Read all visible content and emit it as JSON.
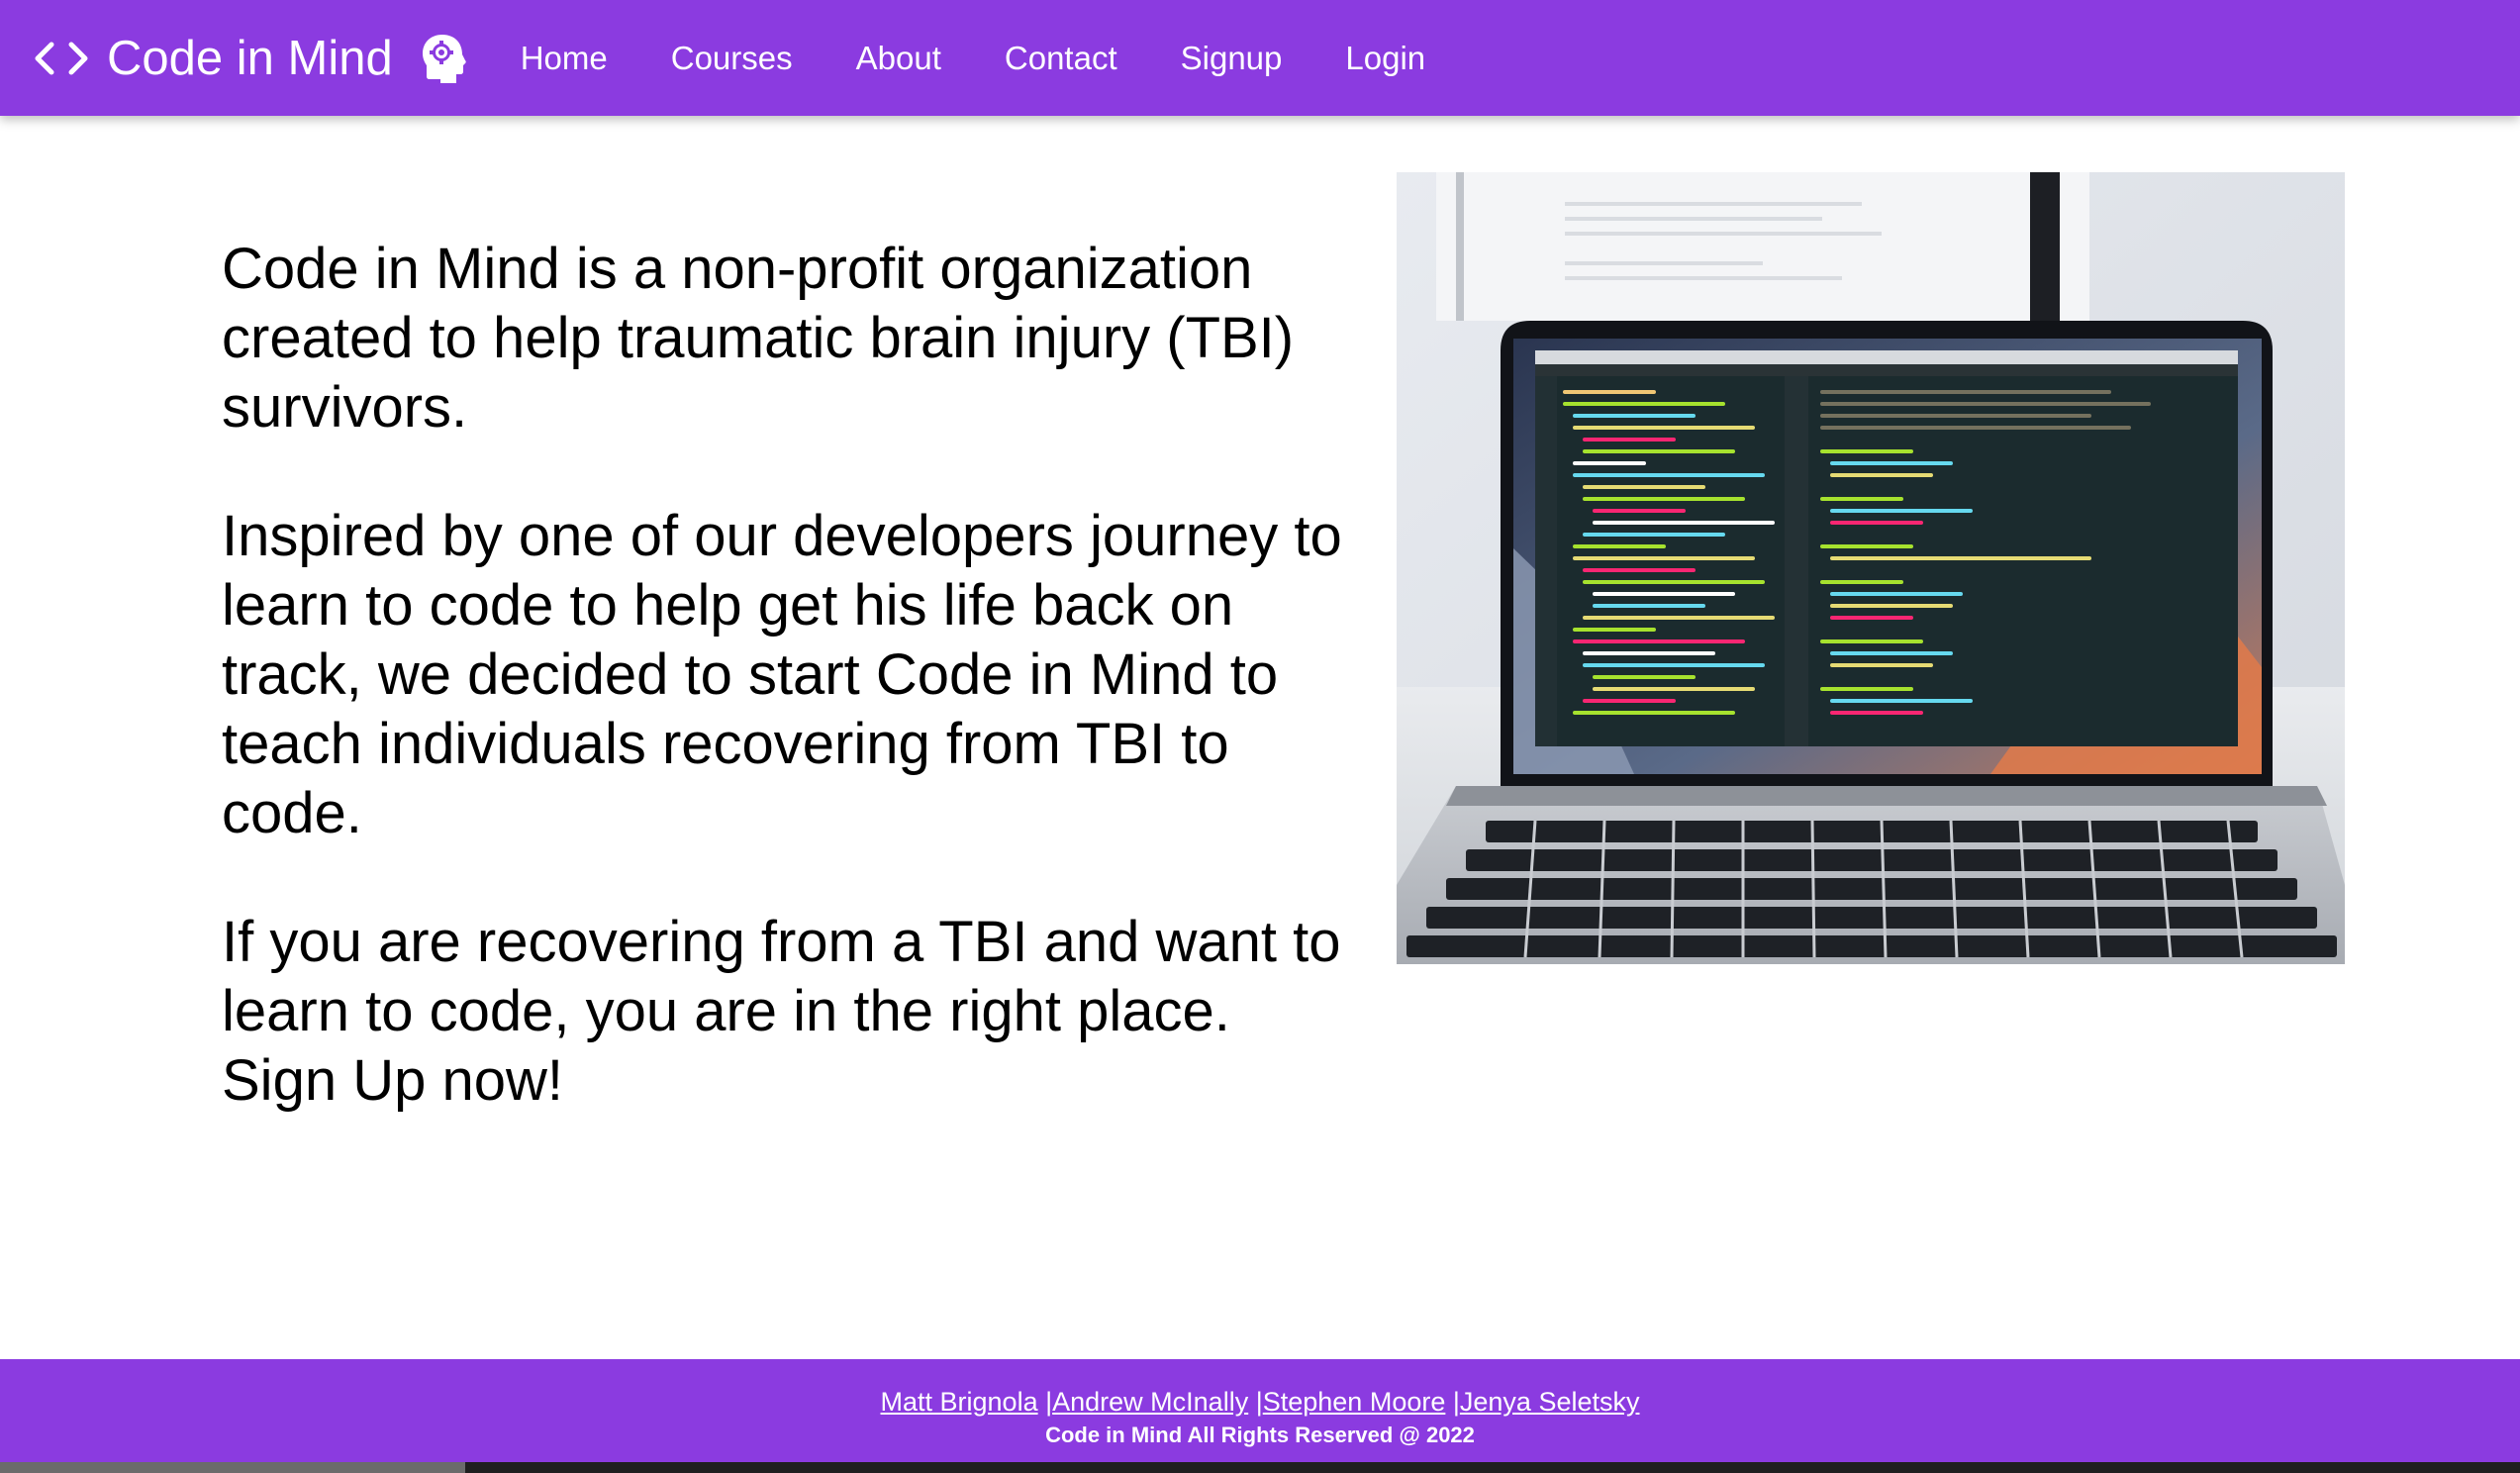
{
  "header": {
    "brand": "Code in Mind",
    "nav": [
      "Home",
      "Courses",
      "About",
      "Contact",
      "Signup",
      "Login"
    ]
  },
  "main": {
    "paragraphs": [
      "Code in Mind is a non-profit organization created to help traumatic brain injury (TBI) survivors.",
      "Inspired by one of our developers journey to learn to code to help get his life back on track, we decided to start Code in Mind to teach individuals recovering from TBI to code.",
      "If you are recovering from a TBI and want to learn to code, you are in the right place. Sign Up now!"
    ]
  },
  "footer": {
    "authors": [
      "Matt Brignola",
      "Andrew McInally",
      "Stephen Moore",
      "Jenya Seletsky"
    ],
    "separator": "|",
    "copyright": "Code in Mind All Rights Reserved @ 2022"
  },
  "colors": {
    "brand_purple": "#8b3be0",
    "text": "#000000",
    "background": "#ffffff"
  },
  "icons": {
    "brand_code": "code-brackets-icon",
    "brand_head": "head-gear-icon"
  }
}
